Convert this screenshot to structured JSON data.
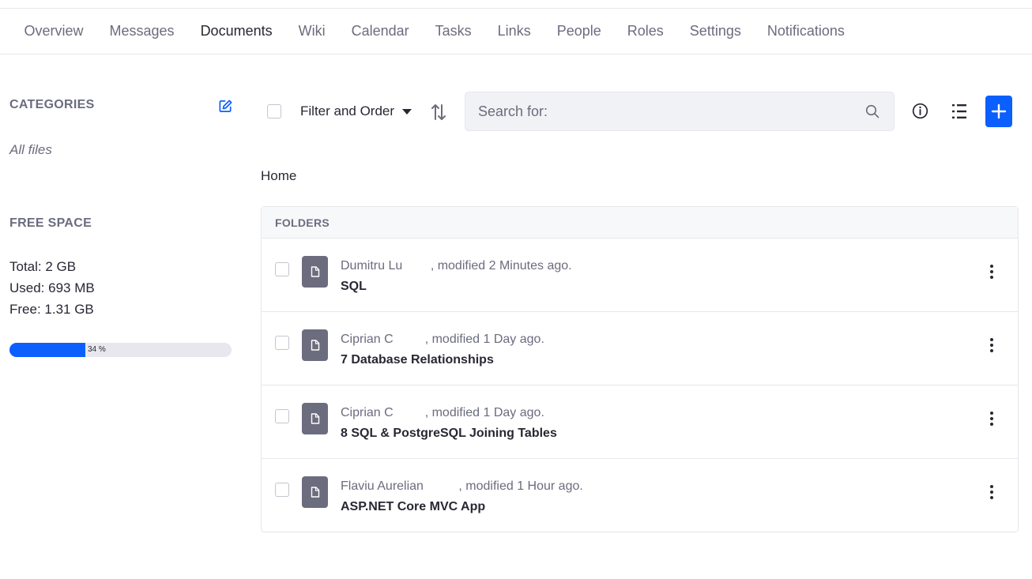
{
  "nav": {
    "items": [
      {
        "label": "Overview",
        "active": false
      },
      {
        "label": "Messages",
        "active": false
      },
      {
        "label": "Documents",
        "active": true
      },
      {
        "label": "Wiki",
        "active": false
      },
      {
        "label": "Calendar",
        "active": false
      },
      {
        "label": "Tasks",
        "active": false
      },
      {
        "label": "Links",
        "active": false
      },
      {
        "label": "People",
        "active": false
      },
      {
        "label": "Roles",
        "active": false
      },
      {
        "label": "Settings",
        "active": false
      },
      {
        "label": "Notifications",
        "active": false
      }
    ]
  },
  "sidebar": {
    "categories_title": "CATEGORIES",
    "edit_icon": "edit-pencil-icon",
    "all_files": "All files",
    "free_space_title": "FREE SPACE",
    "total": "Total: 2 GB",
    "used": "Used: 693 MB",
    "free": "Free: 1.31 GB",
    "usage_percent": 34,
    "usage_label": "34 %"
  },
  "toolbar": {
    "filter_label": "Filter and Order",
    "search_placeholder": "Search for:",
    "search_value": "",
    "icons": [
      "sort-icon",
      "search-icon",
      "info-icon",
      "list-view-icon",
      "plus-icon"
    ]
  },
  "breadcrumb": "Home",
  "folders": {
    "header": "FOLDERS",
    "rows": [
      {
        "meta": "Dumitru Lu        , modified 2 Minutes ago.",
        "title": "SQL"
      },
      {
        "meta": "Ciprian C         , modified 1 Day ago.",
        "title": "7 Database Relationships"
      },
      {
        "meta": "Ciprian C         , modified 1 Day ago.",
        "title": "8 SQL & PostgreSQL Joining Tables"
      },
      {
        "meta": "Flaviu Aurelian          , modified 1 Hour ago.",
        "title": "ASP.NET Core MVC App"
      }
    ]
  },
  "colors": {
    "accent": "#0b5fff",
    "sticker": "#6b6c7e",
    "border": "#e7e7ed"
  }
}
